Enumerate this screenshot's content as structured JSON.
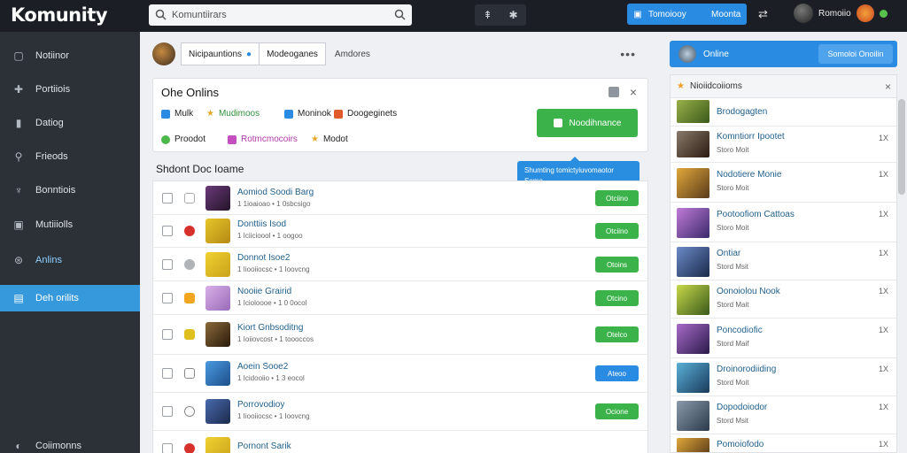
{
  "app": {
    "logo": "Komunity"
  },
  "search": {
    "placeholder": "Komuntiirars"
  },
  "topbar": {
    "icon1": "⇞",
    "icon2": "✱",
    "primary_label": "Tomoiooy",
    "primary_label2": "Moonta",
    "sync_icon": "⇄",
    "user_name": "Romoiio"
  },
  "sidebar": {
    "items": [
      {
        "label": "Notiinor",
        "icon": "▢"
      },
      {
        "label": "Portiiois",
        "icon": "✚"
      },
      {
        "label": "Datiog",
        "icon": "▮"
      },
      {
        "label": "Frieods",
        "icon": "⚲"
      },
      {
        "label": "Bonntiois",
        "icon": "♆"
      },
      {
        "label": "Mutiiiolls",
        "icon": "▣"
      },
      {
        "label": "Anlins",
        "icon": "⊛"
      },
      {
        "label": "Deh orilits",
        "icon": "▤"
      },
      {
        "label": "Coiimonns",
        "icon": "◐"
      }
    ]
  },
  "subhead": {
    "tab1": "Nicipauntions",
    "tab2": "Modeoganes",
    "tab3": "Amdores",
    "more": "•••"
  },
  "panel": {
    "title": "Ohe Onlins",
    "filters": [
      {
        "label": "Mulk",
        "color": "#2a8be3"
      },
      {
        "label": "Mudimoos",
        "color": "#e4a92b"
      },
      {
        "label": "Moninok",
        "color": "#2a8be3"
      },
      {
        "label": "Doogeginets",
        "color": "#e05a2b"
      },
      {
        "label": "Proodot",
        "color": "#4cb84a"
      },
      {
        "label": "Rotmcmocoirs",
        "color": "#c64fc0"
      },
      {
        "label": "Modot",
        "color": "#e4a92b"
      }
    ],
    "action_label": "Noodihnance",
    "ctrl_close": "×"
  },
  "section_title": "Shdont Doc Ioame",
  "tooltip": {
    "text": "Shumting tomictyiuvomaotor Some"
  },
  "list": {
    "rows": [
      {
        "title": "Aomiod Soodi Barg",
        "meta": "1 1ioaioao • 1 0sbcsigo",
        "btn": "Otciino",
        "btn_color": "#3bb34a",
        "st_color": "#ffffff",
        "thumb": "#5a2a5e"
      },
      {
        "title": "Donttiis Isod",
        "meta": "1 Iciicioool • 1 oogoo",
        "btn": "Otciino",
        "btn_color": "#3bb34a",
        "st_color": "#d6312b",
        "thumb": "#d4b21e"
      },
      {
        "title": "Donnot Isoe2",
        "meta": "1 Iiooiiocsc • 1 Ioovcng",
        "btn": "Otoins",
        "btn_color": "#3bb34a",
        "st_color": "#b0b4b9",
        "thumb": "#e5c21c"
      },
      {
        "title": "Nooiie Grairid",
        "meta": "1 Icioloooe • 1 0 0ocol",
        "btn": "Otcino",
        "btn_color": "#3bb34a",
        "st_color": "#f2a51e",
        "thumb": "#c6a0d8"
      },
      {
        "title": "Kiort Gnbsoditng",
        "meta": "1 Ioiiovcost • 1 toooccos",
        "btn": "Otelco",
        "btn_color": "#3bb34a",
        "st_color": "#e0c020",
        "thumb": "#6a4a2a"
      },
      {
        "title": "Aoein Sooe2",
        "meta": "1 Icidooiio • 1 3 eocol",
        "btn": "Ateoo",
        "btn_color": "#2a8be3",
        "st_color": "#ffffff",
        "thumb": "#3a7dc7"
      },
      {
        "title": "Porrovodioy",
        "meta": "1 Iiooiiocsc • 1 Ioovcng",
        "btn": "Ocione",
        "btn_color": "#3bb34a",
        "st_color": "#ffffff",
        "thumb": "#3a4f8a"
      },
      {
        "title": "Pornont Sarik",
        "meta": "",
        "btn": "",
        "btn_color": "#3bb34a",
        "st_color": "#d6312b",
        "thumb": "#e5c21c"
      }
    ]
  },
  "online": {
    "label": "Online",
    "button": "Somoloi Onoilin"
  },
  "rpanel": {
    "title": "Nioiidcoiioms",
    "close": "×",
    "rows": [
      {
        "title": "Brodogagten",
        "sub": "",
        "count": "",
        "thumb": "#6b8e3a"
      },
      {
        "title": "Komntiorr Ipootet",
        "sub": "Storo Moit",
        "count": "1X",
        "thumb": "#5a4a3a"
      },
      {
        "title": "Nodotiere Monie",
        "sub": "Storo Moit",
        "count": "1X",
        "thumb": "#c28a2a"
      },
      {
        "title": "Pootoofiom Cattoas",
        "sub": "Storo Moit",
        "count": "1X",
        "thumb": "#8a4aa8"
      },
      {
        "title": "Ontiar",
        "sub": "Stord Msit",
        "count": "1X",
        "thumb": "#4a5a8a"
      },
      {
        "title": "Oonoiolou Nook",
        "sub": "Stord Mait",
        "count": "1X",
        "thumb": "#8ab02a"
      },
      {
        "title": "Poncodiofic",
        "sub": "Stord Maif",
        "count": "1X",
        "thumb": "#6a3a7a"
      },
      {
        "title": "Droinorodiiding",
        "sub": "Stord Moit",
        "count": "1X",
        "thumb": "#3a8aa8"
      },
      {
        "title": "Dopodoiodor",
        "sub": "Stord Msit",
        "count": "1X",
        "thumb": "#5a6a7a"
      },
      {
        "title": "Pomoiofodo",
        "sub": "",
        "count": "1X",
        "thumb": "#c27a2a"
      }
    ]
  }
}
